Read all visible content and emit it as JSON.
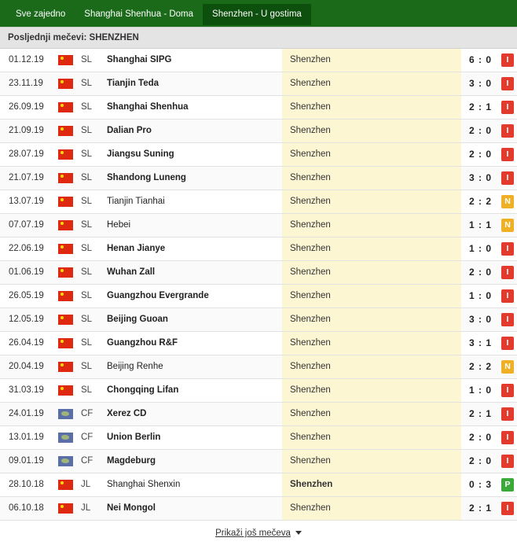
{
  "tabs": [
    {
      "label": "Sve zajedno",
      "active": false
    },
    {
      "label": "Shanghai Shenhua - Doma",
      "active": false
    },
    {
      "label": "Shenzhen - U gostima",
      "active": true
    }
  ],
  "section_title": "Posljednji mečevi: SHENZHEN",
  "colors": {
    "header_green": "#1a6a1a",
    "active_tab": "#0d4f0d",
    "loss": "#e23b2e",
    "draw": "#f0b025",
    "win": "#3aa93a",
    "away_highlight": "#fdf6d3"
  },
  "matches": [
    {
      "date": "01.12.19",
      "flag": "china-flag",
      "comp": "SL",
      "home": "Shanghai SIPG",
      "home_bold": true,
      "away": "Shenzhen",
      "away_bold": false,
      "score": "6 : 0",
      "result": "I"
    },
    {
      "date": "23.11.19",
      "flag": "china-flag",
      "comp": "SL",
      "home": "Tianjin Teda",
      "home_bold": true,
      "away": "Shenzhen",
      "away_bold": false,
      "score": "3 : 0",
      "result": "I"
    },
    {
      "date": "26.09.19",
      "flag": "china-flag",
      "comp": "SL",
      "home": "Shanghai Shenhua",
      "home_bold": true,
      "away": "Shenzhen",
      "away_bold": false,
      "score": "2 : 1",
      "result": "I"
    },
    {
      "date": "21.09.19",
      "flag": "china-flag",
      "comp": "SL",
      "home": "Dalian Pro",
      "home_bold": true,
      "away": "Shenzhen",
      "away_bold": false,
      "score": "2 : 0",
      "result": "I"
    },
    {
      "date": "28.07.19",
      "flag": "china-flag",
      "comp": "SL",
      "home": "Jiangsu Suning",
      "home_bold": true,
      "away": "Shenzhen",
      "away_bold": false,
      "score": "2 : 0",
      "result": "I"
    },
    {
      "date": "21.07.19",
      "flag": "china-flag",
      "comp": "SL",
      "home": "Shandong Luneng",
      "home_bold": true,
      "away": "Shenzhen",
      "away_bold": false,
      "score": "3 : 0",
      "result": "I"
    },
    {
      "date": "13.07.19",
      "flag": "china-flag",
      "comp": "SL",
      "home": "Tianjin Tianhai",
      "home_bold": false,
      "away": "Shenzhen",
      "away_bold": false,
      "score": "2 : 2",
      "result": "N"
    },
    {
      "date": "07.07.19",
      "flag": "china-flag",
      "comp": "SL",
      "home": "Hebei",
      "home_bold": false,
      "away": "Shenzhen",
      "away_bold": false,
      "score": "1 : 1",
      "result": "N"
    },
    {
      "date": "22.06.19",
      "flag": "china-flag",
      "comp": "SL",
      "home": "Henan Jianye",
      "home_bold": true,
      "away": "Shenzhen",
      "away_bold": false,
      "score": "1 : 0",
      "result": "I"
    },
    {
      "date": "01.06.19",
      "flag": "china-flag",
      "comp": "SL",
      "home": "Wuhan Zall",
      "home_bold": true,
      "away": "Shenzhen",
      "away_bold": false,
      "score": "2 : 0",
      "result": "I"
    },
    {
      "date": "26.05.19",
      "flag": "china-flag",
      "comp": "SL",
      "home": "Guangzhou Evergrande",
      "home_bold": true,
      "away": "Shenzhen",
      "away_bold": false,
      "score": "1 : 0",
      "result": "I"
    },
    {
      "date": "12.05.19",
      "flag": "china-flag",
      "comp": "SL",
      "home": "Beijing Guoan",
      "home_bold": true,
      "away": "Shenzhen",
      "away_bold": false,
      "score": "3 : 0",
      "result": "I"
    },
    {
      "date": "26.04.19",
      "flag": "china-flag",
      "comp": "SL",
      "home": "Guangzhou R&F",
      "home_bold": true,
      "away": "Shenzhen",
      "away_bold": false,
      "score": "3 : 1",
      "result": "I"
    },
    {
      "date": "20.04.19",
      "flag": "china-flag",
      "comp": "SL",
      "home": "Beijing Renhe",
      "home_bold": false,
      "away": "Shenzhen",
      "away_bold": false,
      "score": "2 : 2",
      "result": "N"
    },
    {
      "date": "31.03.19",
      "flag": "china-flag",
      "comp": "SL",
      "home": "Chongqing Lifan",
      "home_bold": true,
      "away": "Shenzhen",
      "away_bold": false,
      "score": "1 : 0",
      "result": "I"
    },
    {
      "date": "24.01.19",
      "flag": "world-flag",
      "comp": "CF",
      "home": "Xerez CD",
      "home_bold": true,
      "away": "Shenzhen",
      "away_bold": false,
      "score": "2 : 1",
      "result": "I"
    },
    {
      "date": "13.01.19",
      "flag": "world-flag",
      "comp": "CF",
      "home": "Union Berlin",
      "home_bold": true,
      "away": "Shenzhen",
      "away_bold": false,
      "score": "2 : 0",
      "result": "I"
    },
    {
      "date": "09.01.19",
      "flag": "world-flag",
      "comp": "CF",
      "home": "Magdeburg",
      "home_bold": true,
      "away": "Shenzhen",
      "away_bold": false,
      "score": "2 : 0",
      "result": "I"
    },
    {
      "date": "28.10.18",
      "flag": "china-flag",
      "comp": "JL",
      "home": "Shanghai Shenxin",
      "home_bold": false,
      "away": "Shenzhen",
      "away_bold": true,
      "score": "0 : 3",
      "result": "P"
    },
    {
      "date": "06.10.18",
      "flag": "china-flag",
      "comp": "JL",
      "home": "Nei Mongol",
      "home_bold": true,
      "away": "Shenzhen",
      "away_bold": false,
      "score": "2 : 1",
      "result": "I"
    }
  ],
  "show_more": "Prikaži još mečeva"
}
